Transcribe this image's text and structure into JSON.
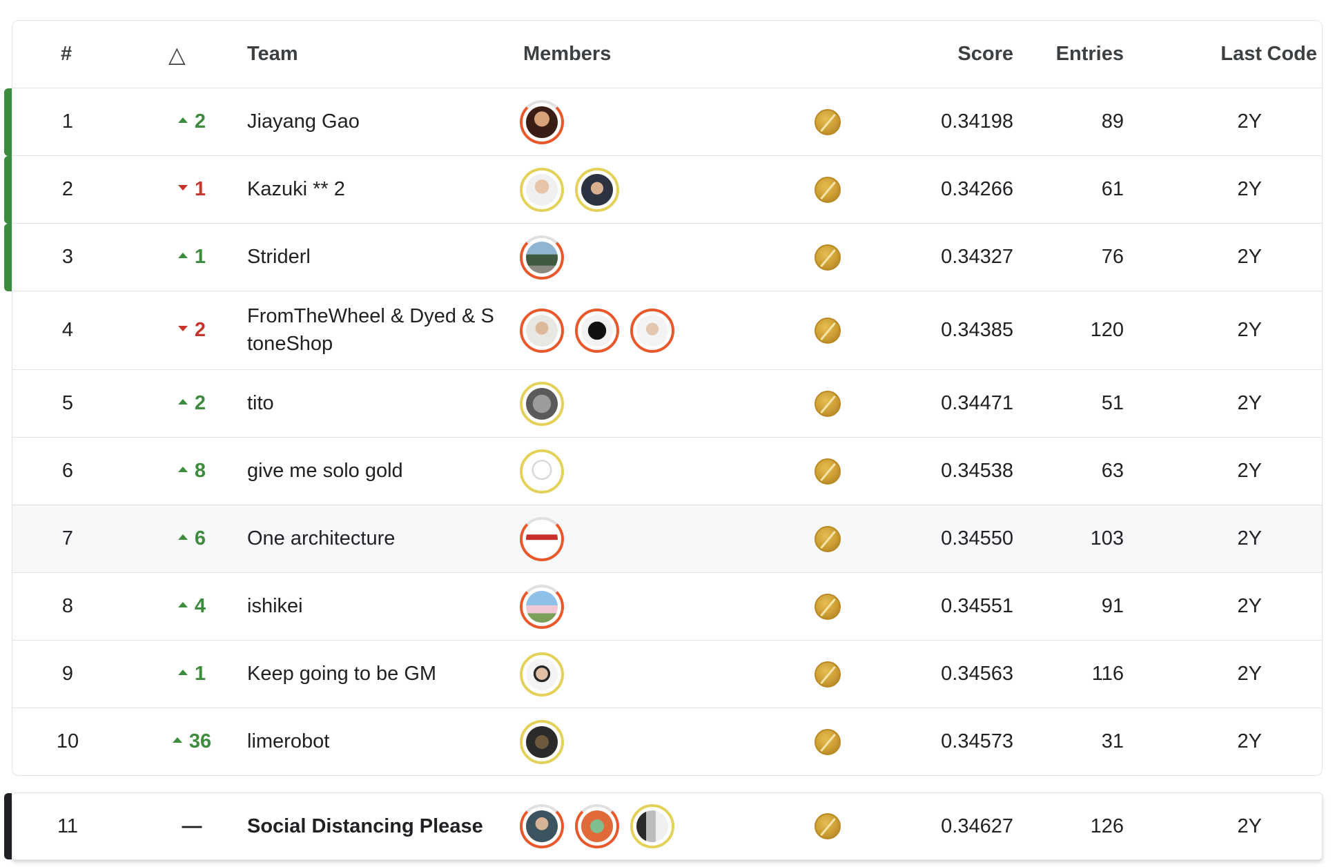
{
  "headers": {
    "rank": "#",
    "delta": "△",
    "team": "Team",
    "members": "Members",
    "score": "Score",
    "entries": "Entries",
    "last": "Last",
    "code": "Code"
  },
  "rows": [
    {
      "rank": "1",
      "delta": "2",
      "dir": "up",
      "team": "Jiayang Gao",
      "score": "0.34198",
      "entries": "89",
      "last": "2Y"
    },
    {
      "rank": "2",
      "delta": "1",
      "dir": "down",
      "team": "Kazuki ** 2",
      "score": "0.34266",
      "entries": "61",
      "last": "2Y"
    },
    {
      "rank": "3",
      "delta": "1",
      "dir": "up",
      "team": "Striderl",
      "score": "0.34327",
      "entries": "76",
      "last": "2Y"
    },
    {
      "rank": "4",
      "delta": "2",
      "dir": "down",
      "team": "FromTheWheel & Dyed & StoneShop",
      "score": "0.34385",
      "entries": "120",
      "last": "2Y"
    },
    {
      "rank": "5",
      "delta": "2",
      "dir": "up",
      "team": "tito",
      "score": "0.34471",
      "entries": "51",
      "last": "2Y"
    },
    {
      "rank": "6",
      "delta": "8",
      "dir": "up",
      "team": "give me solo gold",
      "score": "0.34538",
      "entries": "63",
      "last": "2Y"
    },
    {
      "rank": "7",
      "delta": "6",
      "dir": "up",
      "team": "One architecture",
      "score": "0.34550",
      "entries": "103",
      "last": "2Y"
    },
    {
      "rank": "8",
      "delta": "4",
      "dir": "up",
      "team": "ishikei",
      "score": "0.34551",
      "entries": "91",
      "last": "2Y"
    },
    {
      "rank": "9",
      "delta": "1",
      "dir": "up",
      "team": "Keep going to be GM",
      "score": "0.34563",
      "entries": "116",
      "last": "2Y"
    },
    {
      "rank": "10",
      "delta": "36",
      "dir": "up",
      "team": "limerobot",
      "score": "0.34573",
      "entries": "31",
      "last": "2Y"
    }
  ],
  "self_row": {
    "rank": "11",
    "delta": "—",
    "team": "Social Distancing Please",
    "score": "0.34627",
    "entries": "126",
    "last": "2Y"
  },
  "icons": {
    "medal": "gold-medal-icon",
    "delta_up": "caret-up-icon",
    "delta_down": "caret-down-icon",
    "avatar": "user-avatar"
  },
  "colors": {
    "up": "#3d8b3d",
    "down": "#c5352b",
    "gold_ring": "#e3d15a",
    "red_ring": "#e8582a",
    "medal": "#c99a30"
  }
}
